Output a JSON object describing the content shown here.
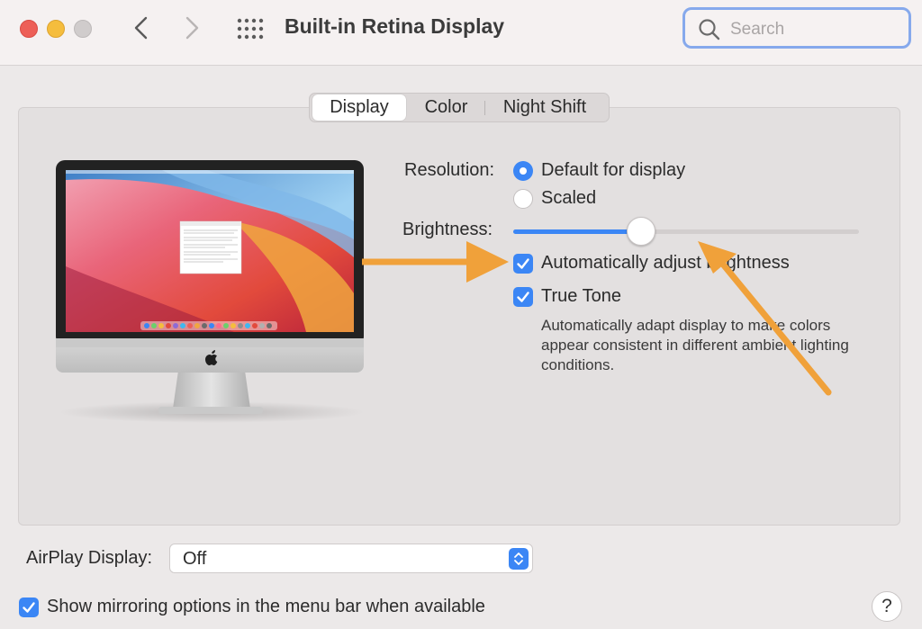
{
  "window": {
    "title": "Built-in Retina Display",
    "search_placeholder": "Search"
  },
  "toolbar": {
    "icons": [
      "close-button",
      "minimize-button",
      "zoom-button",
      "chevron-left-icon",
      "chevron-right-icon",
      "grid-icon",
      "search-icon"
    ]
  },
  "tabs": [
    {
      "label": "Display",
      "selected": true
    },
    {
      "label": "Color",
      "selected": false
    },
    {
      "label": "Night Shift",
      "selected": false
    }
  ],
  "resolution": {
    "label": "Resolution:",
    "options": [
      {
        "label": "Default for display",
        "selected": true
      },
      {
        "label": "Scaled",
        "selected": false
      }
    ]
  },
  "brightness": {
    "label": "Brightness:",
    "value": 0.37
  },
  "auto_brightness": {
    "label": "Automatically adjust brightness",
    "checked": true
  },
  "true_tone": {
    "label": "True Tone",
    "checked": true,
    "description": "Automatically adapt display to make colors appear consistent in different ambient lighting conditions."
  },
  "airplay": {
    "label": "AirPlay Display:",
    "value": "Off"
  },
  "mirroring": {
    "label": "Show mirroring options in the menu bar when available",
    "checked": true
  },
  "help": {
    "label": "?"
  },
  "colors": {
    "accent": "#3b86f5",
    "annotation_arrow": "#f0a13a"
  }
}
